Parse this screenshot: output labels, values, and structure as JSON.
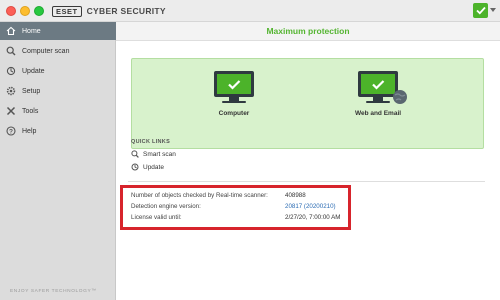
{
  "app": {
    "logo_text": "ESET",
    "name": "CYBER SECURITY"
  },
  "sidebar": {
    "items": [
      {
        "label": "Home",
        "icon": "home-icon"
      },
      {
        "label": "Computer scan",
        "icon": "magnifier-icon"
      },
      {
        "label": "Update",
        "icon": "refresh-icon"
      },
      {
        "label": "Setup",
        "icon": "gear-icon"
      },
      {
        "label": "Tools",
        "icon": "tools-icon"
      },
      {
        "label": "Help",
        "icon": "help-icon"
      }
    ],
    "footer": "ENJOY SAFER TECHNOLOGY™"
  },
  "main": {
    "header_title": "Maximum protection",
    "protection": [
      {
        "label": "Computer",
        "icon": "monitor-check-icon"
      },
      {
        "label": "Web and Email",
        "icon": "monitor-check-globe-icon"
      }
    ],
    "quick_links_title": "QUICK LINKS",
    "quick_links": [
      {
        "label": "Smart scan",
        "icon": "scan-icon"
      },
      {
        "label": "Update",
        "icon": "refresh-icon"
      }
    ],
    "info": [
      {
        "label": "Number of objects checked by Real-time scanner:",
        "value": "408988"
      },
      {
        "label": "Detection engine version:",
        "value": "20817 (20200210)"
      },
      {
        "label": "License valid until:",
        "value": "2/27/20, 7:00:00 AM"
      }
    ]
  },
  "colors": {
    "accent_green": "#55b532",
    "protect_bg": "#d8f2cc",
    "highlight_red": "#d7242c",
    "link_blue": "#2a6bb3",
    "sidebar_active": "#6c7a83"
  }
}
